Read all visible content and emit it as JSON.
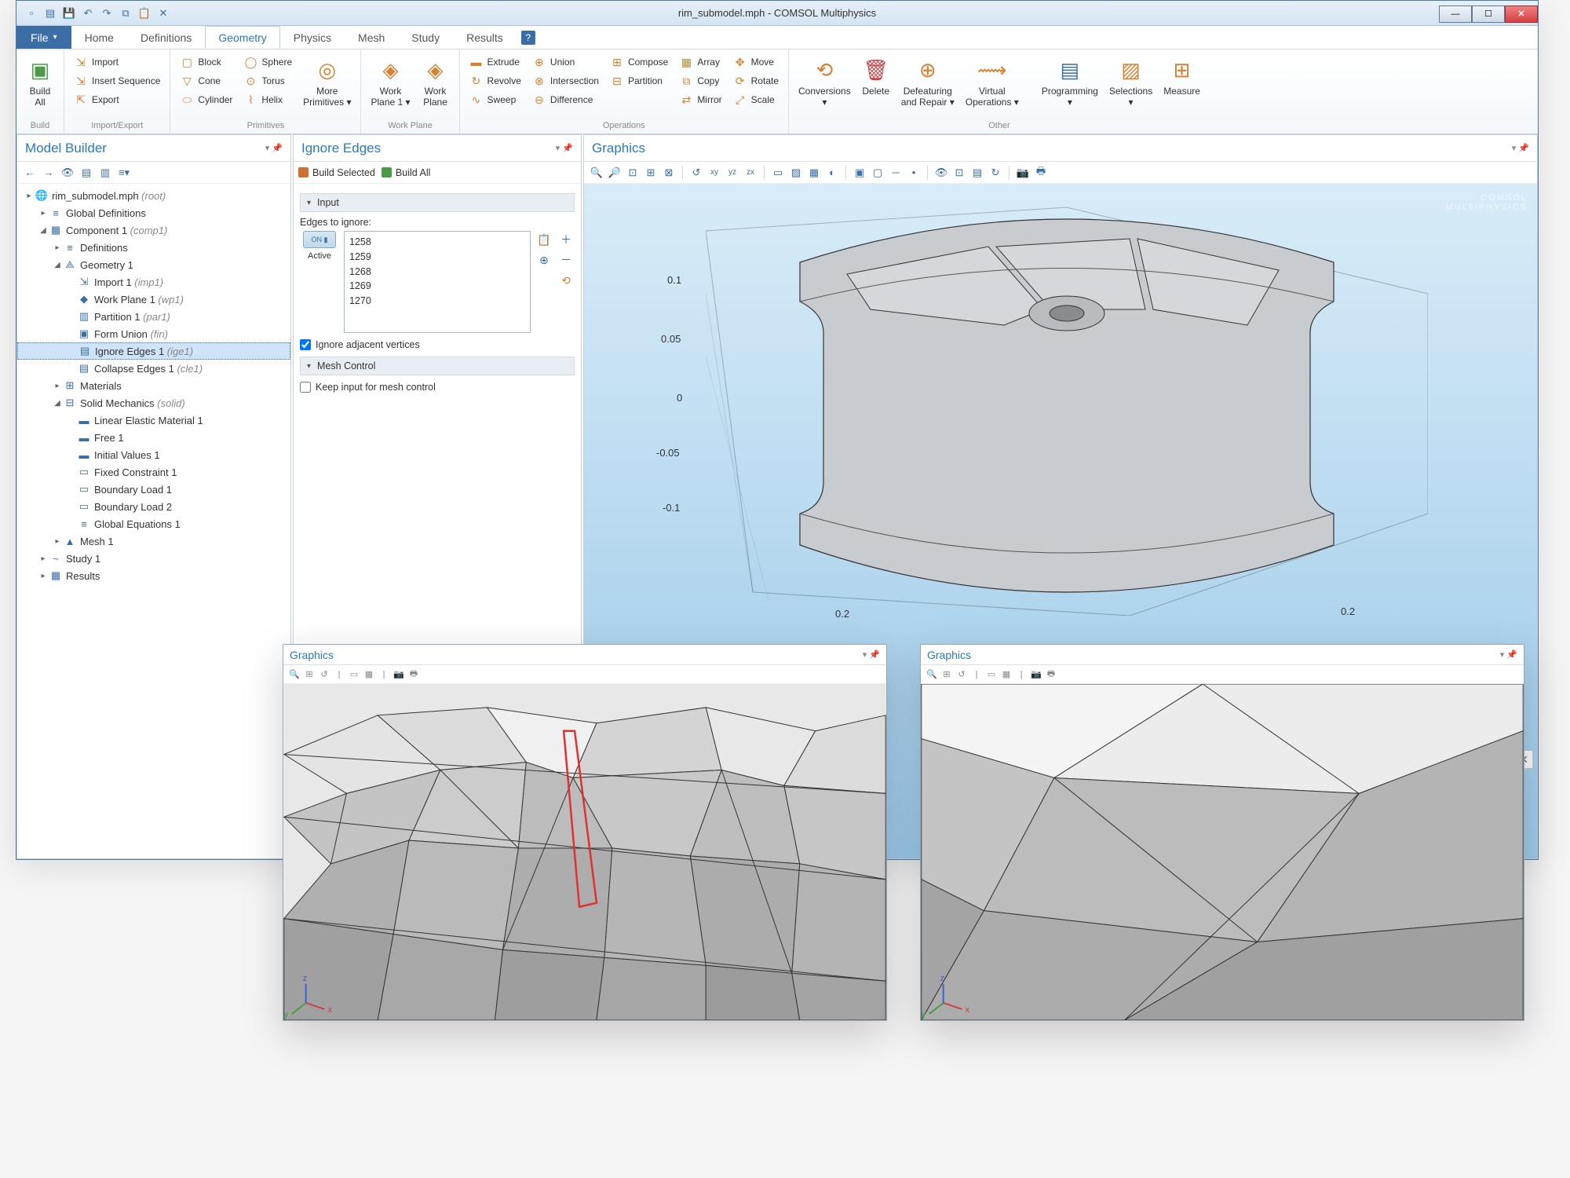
{
  "window": {
    "title": "rim_submodel.mph - COMSOL Multiphysics"
  },
  "tabs": [
    "Home",
    "Definitions",
    "Geometry",
    "Physics",
    "Mesh",
    "Study",
    "Results"
  ],
  "active_tab": "Geometry",
  "ribbon": {
    "build": {
      "big": {
        "label": "Build\nAll"
      },
      "group": "Build"
    },
    "import_export": {
      "items": [
        "Import",
        "Insert Sequence",
        "Export"
      ],
      "group": "Import/Export"
    },
    "primitives": {
      "col1": [
        "Block",
        "Cone",
        "Cylinder"
      ],
      "col2": [
        "Sphere",
        "Torus",
        "Helix"
      ],
      "more": "More\nPrimitives ▾",
      "group": "Primitives"
    },
    "workplane": {
      "b1": "Work\nPlane 1 ▾",
      "b2": "Work\nPlane",
      "group": "Work Plane"
    },
    "booleans": {
      "col1": [
        "Extrude",
        "Revolve",
        "Sweep"
      ],
      "col2": [
        "Union",
        "Intersection",
        "Difference"
      ],
      "col3": [
        "Compose",
        "Partition",
        ""
      ],
      "col4": [
        "Array",
        "Copy",
        "Mirror"
      ],
      "col5": [
        "Move",
        "Rotate",
        "Scale"
      ],
      "group": "Operations"
    },
    "other_big": {
      "conversions": "Conversions\n▾",
      "delete": "Delete",
      "defeaturing": "Defeaturing\nand Repair ▾",
      "virtual": "Virtual\nOperations ▾",
      "programming": "Programming\n▾",
      "selections": "Selections\n▾",
      "measure": "Measure",
      "group": "Other"
    }
  },
  "model_builder": {
    "title": "Model Builder",
    "tree": [
      {
        "d": 0,
        "t": "▸",
        "i": "🌐",
        "l": "rim_submodel.mph ",
        "em": "(root)"
      },
      {
        "d": 1,
        "t": "▸",
        "i": "≡",
        "l": "Global Definitions"
      },
      {
        "d": 1,
        "t": "◢",
        "i": "▦",
        "l": "Component 1 ",
        "em": "(comp1)"
      },
      {
        "d": 2,
        "t": "▸",
        "i": "≡",
        "l": "Definitions"
      },
      {
        "d": 2,
        "t": "◢",
        "i": "⟁",
        "l": "Geometry 1"
      },
      {
        "d": 3,
        "t": "",
        "i": "⇲",
        "l": "Import 1 ",
        "em": "(imp1)"
      },
      {
        "d": 3,
        "t": "",
        "i": "◆",
        "l": "Work Plane 1 ",
        "em": "(wp1)"
      },
      {
        "d": 3,
        "t": "",
        "i": "▥",
        "l": "Partition 1 ",
        "em": "(par1)"
      },
      {
        "d": 3,
        "t": "",
        "i": "▣",
        "l": "Form Union ",
        "em": "(fin)"
      },
      {
        "d": 3,
        "t": "",
        "i": "▤",
        "l": "Ignore Edges 1 ",
        "em": "(ige1)",
        "sel": true
      },
      {
        "d": 3,
        "t": "",
        "i": "▤",
        "l": "Collapse Edges 1 ",
        "em": "(cle1)"
      },
      {
        "d": 2,
        "t": "▸",
        "i": "⊞",
        "l": "Materials"
      },
      {
        "d": 2,
        "t": "◢",
        "i": "⊟",
        "l": "Solid Mechanics ",
        "em": "(solid)"
      },
      {
        "d": 3,
        "t": "",
        "i": "▬",
        "l": "Linear Elastic Material 1"
      },
      {
        "d": 3,
        "t": "",
        "i": "▬",
        "l": "Free 1"
      },
      {
        "d": 3,
        "t": "",
        "i": "▬",
        "l": "Initial Values 1"
      },
      {
        "d": 3,
        "t": "",
        "i": "▭",
        "l": "Fixed Constraint 1"
      },
      {
        "d": 3,
        "t": "",
        "i": "▭",
        "l": "Boundary Load 1"
      },
      {
        "d": 3,
        "t": "",
        "i": "▭",
        "l": "Boundary Load 2"
      },
      {
        "d": 3,
        "t": "",
        "i": "≡",
        "l": "Global Equations 1"
      },
      {
        "d": 2,
        "t": "▸",
        "i": "▲",
        "l": "Mesh 1"
      },
      {
        "d": 1,
        "t": "▸",
        "i": "~",
        "l": "Study 1"
      },
      {
        "d": 1,
        "t": "▸",
        "i": "▦",
        "l": "Results"
      }
    ]
  },
  "settings": {
    "title": "Ignore Edges",
    "build_selected": "Build Selected",
    "build_all": "Build All",
    "section_input": "Input",
    "label_edges": "Edges to ignore:",
    "active": "Active",
    "edges": [
      "1258",
      "1259",
      "1268",
      "1269",
      "1270"
    ],
    "chk_adjacent": "Ignore adjacent vertices",
    "section_mesh": "Mesh Control",
    "chk_keep": "Keep input for mesh control"
  },
  "graphics": {
    "title": "Graphics",
    "watermark": "COMSOL\nMULTIPHYSICS",
    "axis_y": [
      "0.1",
      "0.05",
      "0",
      "-0.05",
      "-0.1"
    ],
    "axis_x1": "0.2",
    "axis_x2": "0.2"
  },
  "float": {
    "title": "Graphics"
  }
}
